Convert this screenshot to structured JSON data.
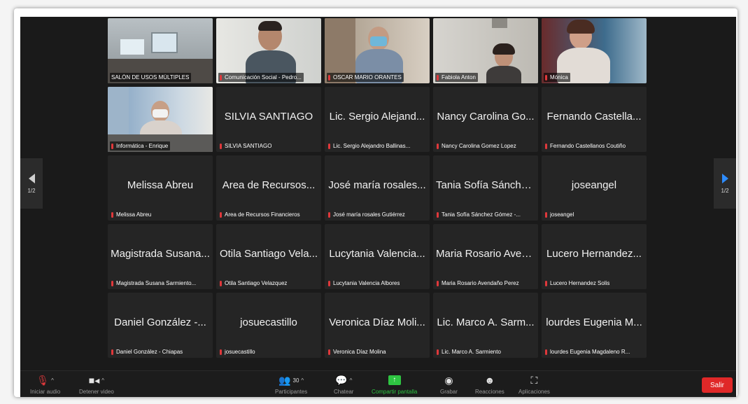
{
  "tiles": [
    {
      "label": "SALÓN DE USOS MÚLTIPLES",
      "big": "",
      "video": true,
      "active": true
    },
    {
      "label": "Comunicación Social - Pedro...",
      "big": "",
      "video": true
    },
    {
      "label": "OSCAR MARIO ORANTES",
      "big": "",
      "video": true
    },
    {
      "label": "Fabiola Anton",
      "big": "",
      "video": true
    },
    {
      "label": "Mónica",
      "big": "",
      "video": true
    },
    {
      "label": "Informática - Enrique",
      "big": "",
      "video": true
    },
    {
      "label": "SILVIA SANTIAGO",
      "big": "SILVIA SANTIAGO"
    },
    {
      "label": "Lic. Sergio Alejandro Ballinas...",
      "big": "Lic. Sergio Alejand..."
    },
    {
      "label": "Nancy Carolina Gomez Lopez",
      "big": "Nancy Carolina Go..."
    },
    {
      "label": "Fernando Castellanos Coutiño",
      "big": "Fernando Castella..."
    },
    {
      "label": "Melissa Abreu",
      "big": "Melissa Abreu"
    },
    {
      "label": "Area de Recursos Financieros",
      "big": "Area de Recursos..."
    },
    {
      "label": "José maría rosales Gutiérrez",
      "big": "José maría rosales..."
    },
    {
      "label": "Tania Sofía Sánchez Gómez -...",
      "big": "Tania Sofía Sánche..."
    },
    {
      "label": "joseangel",
      "big": "joseangel"
    },
    {
      "label": "Magistrada Susana Sarmiento...",
      "big": "Magistrada Susana..."
    },
    {
      "label": "Otila Santiago Velazquez",
      "big": "Otila Santiago Vela..."
    },
    {
      "label": "Lucytania Valencia Albores",
      "big": "Lucytania Valencia..."
    },
    {
      "label": "Maria Rosario Avendaño Perez",
      "big": "Maria Rosario Aven..."
    },
    {
      "label": "Lucero Hernandez Solis",
      "big": "Lucero Hernandez..."
    },
    {
      "label": "Daniel González - Chiapas",
      "big": "Daniel González -..."
    },
    {
      "label": "josuecastillo",
      "big": "josuecastillo"
    },
    {
      "label": "Veronica Díaz Molina",
      "big": "Veronica Díaz Moli..."
    },
    {
      "label": "Lic. Marco A. Sarmiento",
      "big": "Lic. Marco A. Sarm..."
    },
    {
      "label": "lourdes Eugenia Magdaleno R...",
      "big": "lourdes Eugenia M..."
    }
  ],
  "pager": {
    "left": "1/2",
    "right": "1/2"
  },
  "toolbar": {
    "audio_label": "Iniciar audio",
    "video_label": "Detener video",
    "participants_count": "30",
    "participants_label": "Participantes",
    "chat_label": "Chatear",
    "share_label": "Compartir pantalla",
    "record_label": "Grabar",
    "reactions_label": "Reacciones",
    "apps_label": "Aplicaciones",
    "leave_label": "Salir"
  },
  "colors": {
    "active_speaker": "#2ec542",
    "share": "#2ec542",
    "leave": "#e02828",
    "next_arrow": "#2d8cff",
    "muted_mic": "#e0383b"
  },
  "icons": {
    "audio": "muted-mic-icon",
    "video": "video-camera-icon",
    "participants": "participants-icon",
    "chat": "chat-bubble-icon",
    "share": "share-screen-icon",
    "record": "record-icon",
    "reactions": "reactions-icon",
    "apps": "apps-icon"
  }
}
